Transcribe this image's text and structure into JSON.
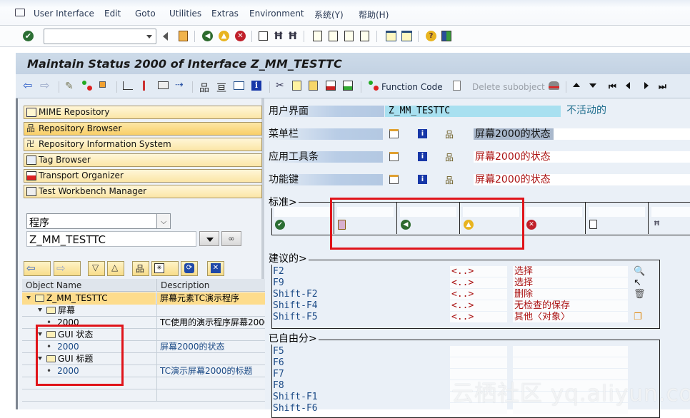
{
  "menubar": {
    "items": [
      "User Interface",
      "Edit",
      "Goto",
      "Utilities",
      "Extras",
      "Environment",
      "系统(Y)",
      "帮助(H)"
    ]
  },
  "system_toolbar": {
    "command_field_value": "",
    "icons": [
      "enter-icon",
      "back-nav-icon",
      "save-icon",
      "back-icon",
      "exit-icon",
      "cancel-icon",
      "print-icon",
      "find-icon",
      "find-next-icon",
      "first-page-icon",
      "previous-page-icon",
      "next-page-icon",
      "last-page-icon",
      "new-session-icon",
      "shortcut-icon",
      "help-icon",
      "layout-icon"
    ]
  },
  "title": "Maintain Status 2000 of Interface Z_MM_TESTTC",
  "app_toolbar": {
    "icons_left": [
      "back-arrow-icon",
      "forward-arrow-icon",
      "display-change-icon",
      "activate-icon",
      "other-object-icon",
      "check-icon",
      "where-used-icon",
      "test-icon",
      "navigate-icon",
      "hierarchy-icon",
      "display-object-list-icon",
      "function-list-icon",
      "info-icon",
      "cut-icon",
      "copy-icon",
      "paste-icon",
      "delete-row-icon",
      "insert-row-icon"
    ],
    "function_code_label": "Function Code",
    "delete_subobject_label": "Delete subobject",
    "icons_right": [
      "hat-icon",
      "previous-up-icon",
      "next-down-icon",
      "first-icon",
      "previous-icon",
      "next-icon",
      "last-icon"
    ]
  },
  "navigation": {
    "buttons": [
      {
        "label": "MIME Repository",
        "icon": "mime-icon",
        "selected": false
      },
      {
        "label": "Repository Browser",
        "icon": "repository-browser-icon",
        "selected": true
      },
      {
        "label": "Repository Information System",
        "icon": "repository-info-icon",
        "selected": false
      },
      {
        "label": "Tag Browser",
        "icon": "tag-browser-icon",
        "selected": false
      },
      {
        "label": "Transport Organizer",
        "icon": "transport-truck-icon",
        "selected": false
      },
      {
        "label": "Test Workbench Manager",
        "icon": "test-workbench-icon",
        "selected": false
      }
    ],
    "object_type_select": "程序",
    "object_name_input": "Z_MM_TESTTC"
  },
  "tree": {
    "columns": [
      "Object Name",
      "Description"
    ],
    "rows": [
      {
        "name": "Z_MM_TESTTC",
        "desc": "屏幕元素TC演示程序",
        "level": 0,
        "type": "folder",
        "highlight": true
      },
      {
        "name": "屏幕",
        "desc": "",
        "level": 1,
        "type": "folder",
        "highlight": false
      },
      {
        "name": "2000",
        "desc": "TC使用的演示程序屏幕2000",
        "level": 2,
        "type": "leaf",
        "highlight": false,
        "link": false
      },
      {
        "name": "GUI 状态",
        "desc": "",
        "level": 1,
        "type": "folder",
        "highlight": false
      },
      {
        "name": "2000",
        "desc": "屏幕2000的状态",
        "level": 2,
        "type": "leaf",
        "highlight": false,
        "link": true
      },
      {
        "name": "GUI 标题",
        "desc": "",
        "level": 1,
        "type": "folder",
        "highlight": false
      },
      {
        "name": "2000",
        "desc": "TC演示屏幕2000的标题",
        "level": 2,
        "type": "leaf",
        "highlight": false,
        "link": true
      }
    ]
  },
  "status_editor": {
    "user_interface_label": "用户界面",
    "user_interface_value": "Z_MM_TESTTC",
    "user_interface_status": "不活动的",
    "rows": [
      {
        "label": "菜单栏",
        "value": "屏幕2000的状态",
        "selected": true
      },
      {
        "label": "应用工具条",
        "value": "屏幕2000的状态",
        "selected": false
      },
      {
        "label": "功能键",
        "value": "屏幕2000的状态",
        "selected": false
      }
    ],
    "standard_group_label": "标准>",
    "standard_keys": [
      {
        "icon": "enter-icon",
        "value": ""
      },
      {
        "icon": "save-icon",
        "value": ""
      },
      {
        "icon": "back-icon",
        "value": ""
      },
      {
        "icon": "exit-icon",
        "value": ""
      },
      {
        "icon": "cancel-icon",
        "value": ""
      },
      {
        "icon": "print-icon",
        "value": ""
      },
      {
        "icon": "find-icon",
        "value": ""
      }
    ],
    "recommended_group_label": "建议的>",
    "recommended_keys": [
      {
        "key": "F2",
        "code": "<..>",
        "text": "选择",
        "icon": "magnify-icon"
      },
      {
        "key": "F9",
        "code": "<..>",
        "text": "选择",
        "icon": "select-pointer-icon"
      },
      {
        "key": "Shift-F2",
        "code": "<..>",
        "text": "删除",
        "icon": "trash-icon"
      },
      {
        "key": "Shift-F4",
        "code": "<..>",
        "text": "无检查的保存",
        "icon": ""
      },
      {
        "key": "Shift-F5",
        "code": "<..>",
        "text": "其他〈对象〉",
        "icon": "other-object-icon"
      }
    ],
    "free_group_label": "已自由分>",
    "free_keys": [
      "F5",
      "F6",
      "F7",
      "F8",
      "Shift-F1",
      "Shift-F6"
    ]
  },
  "watermark": "云栖社区 yq.aliyun.com",
  "colors": {
    "title_bg": "#c8d7e8",
    "highlight_row": "#fddc8c",
    "link_blue": "#1b4a86",
    "red_text": "#a11111",
    "annotation_red": "#e0141a"
  }
}
